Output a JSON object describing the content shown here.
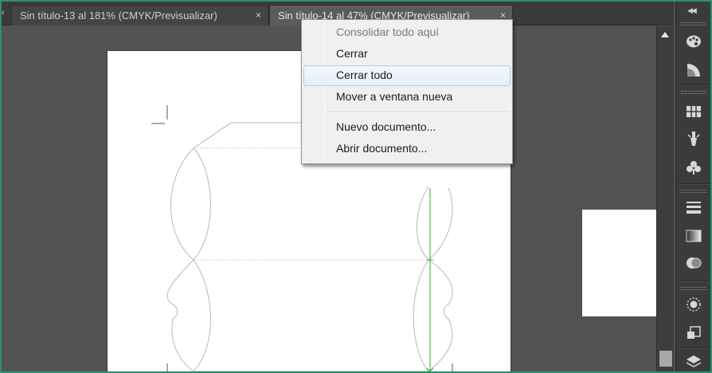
{
  "tabs": [
    {
      "label": "Sin título-13 al 181% (CMYK/Previsualizar)",
      "active": false
    },
    {
      "label": "Sin título-14 al 47% (CMYK/Previsualizar)",
      "active": true
    }
  ],
  "tab_close_glyph": "×",
  "context_menu": {
    "items": [
      {
        "label": "Consolidar todo aquí",
        "enabled": false
      },
      {
        "label": "Cerrar",
        "enabled": true
      },
      {
        "label": "Cerrar todo",
        "enabled": true,
        "highlighted": true
      },
      {
        "label": "Mover a ventana nueva",
        "enabled": true
      },
      {
        "label": "Nuevo documento...",
        "enabled": true
      },
      {
        "label": "Abrir documento...",
        "enabled": true
      }
    ]
  },
  "panel_icons": [
    "color-palette-icon",
    "color-guide-icon",
    "swatches-icon",
    "brushes-icon",
    "symbols-icon",
    "stroke-icon",
    "gradient-icon",
    "transparency-icon",
    "appearance-icon",
    "graphic-styles-icon",
    "layers-icon"
  ],
  "colors": {
    "workspace": "#535353",
    "panel": "#3b3b3b",
    "menu_bg": "#f0f0f0",
    "menu_highlight": "#e6eef9",
    "dieline": "#b5b5b5",
    "guide": "#2bb02b"
  }
}
